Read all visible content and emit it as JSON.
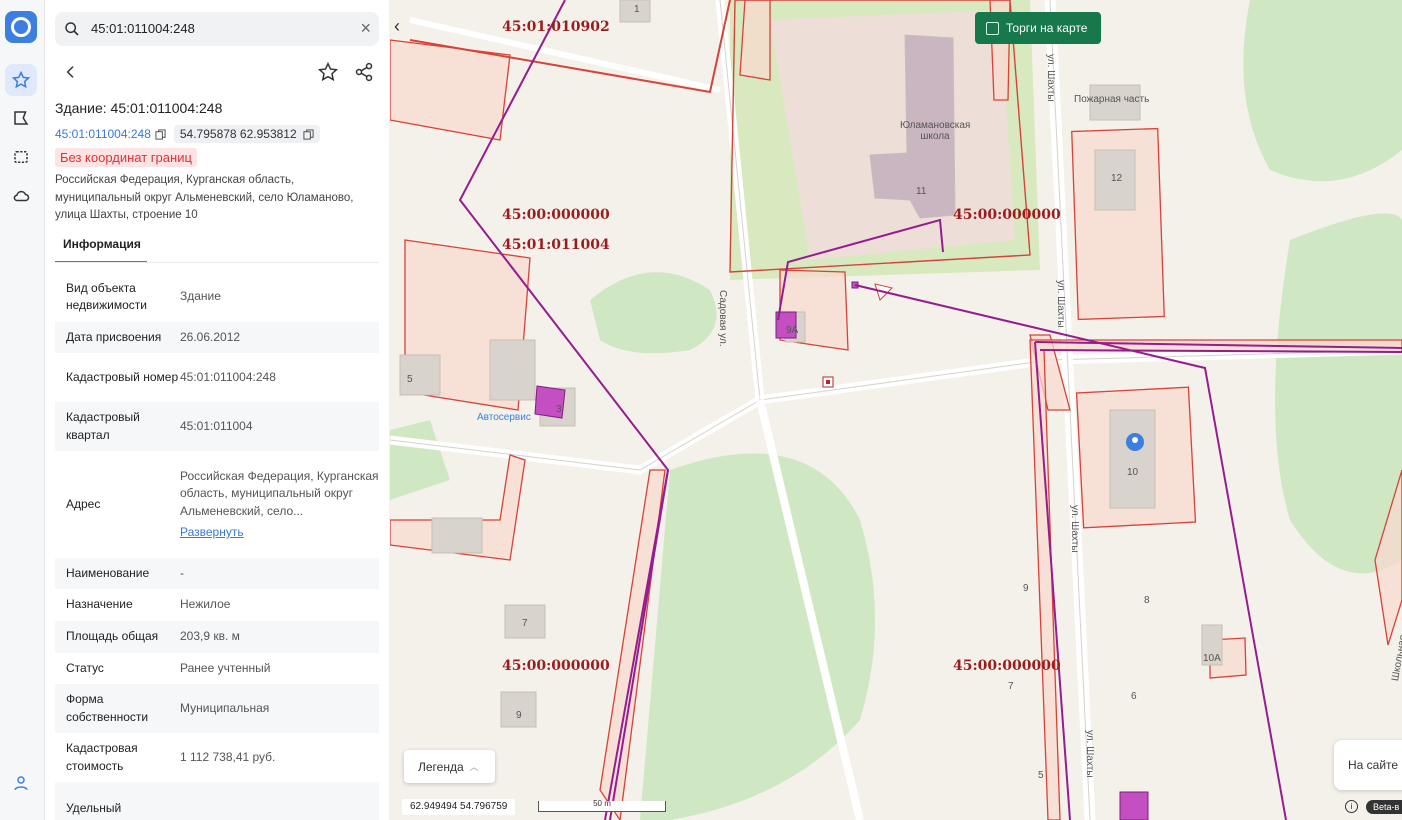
{
  "search": {
    "query": "45:01:011004:248"
  },
  "object": {
    "title": "Здание: 45:01:011004:248",
    "cad_link": "45:01:011004:248",
    "coords": "54.795878 62.953812",
    "badge": "Без координат границ",
    "address": "Российская Федерация, Курганская область, муниципальный округ Альменевский, село Юламаново, улица Шахты, строение 10"
  },
  "tabs": {
    "info": "Информация"
  },
  "rows": [
    {
      "k": "Вид объекта недвижимости",
      "v": "Здание"
    },
    {
      "k": "Дата присвоения",
      "v": "26.06.2012"
    },
    {
      "k": "Кадастровый номер",
      "v": "45:01:011004:248"
    },
    {
      "k": "Кадастровый квартал",
      "v": "45:01:011004"
    },
    {
      "k": "Адрес",
      "v": "Российская Федерация, Курганская область, муниципальный округ Альменевский, село...",
      "more": "Развернуть"
    },
    {
      "k": "Наименование",
      "v": "-"
    },
    {
      "k": "Назначение",
      "v": "Нежилое"
    },
    {
      "k": "Площадь общая",
      "v": "203,9  кв. м"
    },
    {
      "k": "Статус",
      "v": "Ранее учтенный"
    },
    {
      "k": "Форма собственности",
      "v": "Муниципальная"
    },
    {
      "k": "Кадастровая стоимость",
      "v": "1 112 738,41 руб."
    },
    {
      "k": "Удельный",
      "v": ""
    }
  ],
  "map": {
    "torgi": "Торги на карте",
    "legend": "Легенда",
    "coords": "62.949494  54.796759",
    "scale": "50 m",
    "na_saite": "На сайте",
    "beta": "Beta-в",
    "quarters": [
      "45:01:010902",
      "45:00:000000",
      "45:01:011004",
      "45:00:000000",
      "45:00:000000",
      "45:00:000000"
    ],
    "pois": {
      "fire": "Пожарная часть",
      "school": "Юламановская школа",
      "auto": "Автосервис"
    },
    "streets": {
      "sadovaya": "Садовая ул.",
      "shakhty": "ул. Шахты",
      "shkolnaya": "Школьная ул."
    },
    "houses": [
      "1",
      "11",
      "12",
      "9А",
      "5",
      "3",
      "10",
      "7",
      "9",
      "9",
      "8",
      "10А",
      "7",
      "6",
      "5"
    ]
  }
}
